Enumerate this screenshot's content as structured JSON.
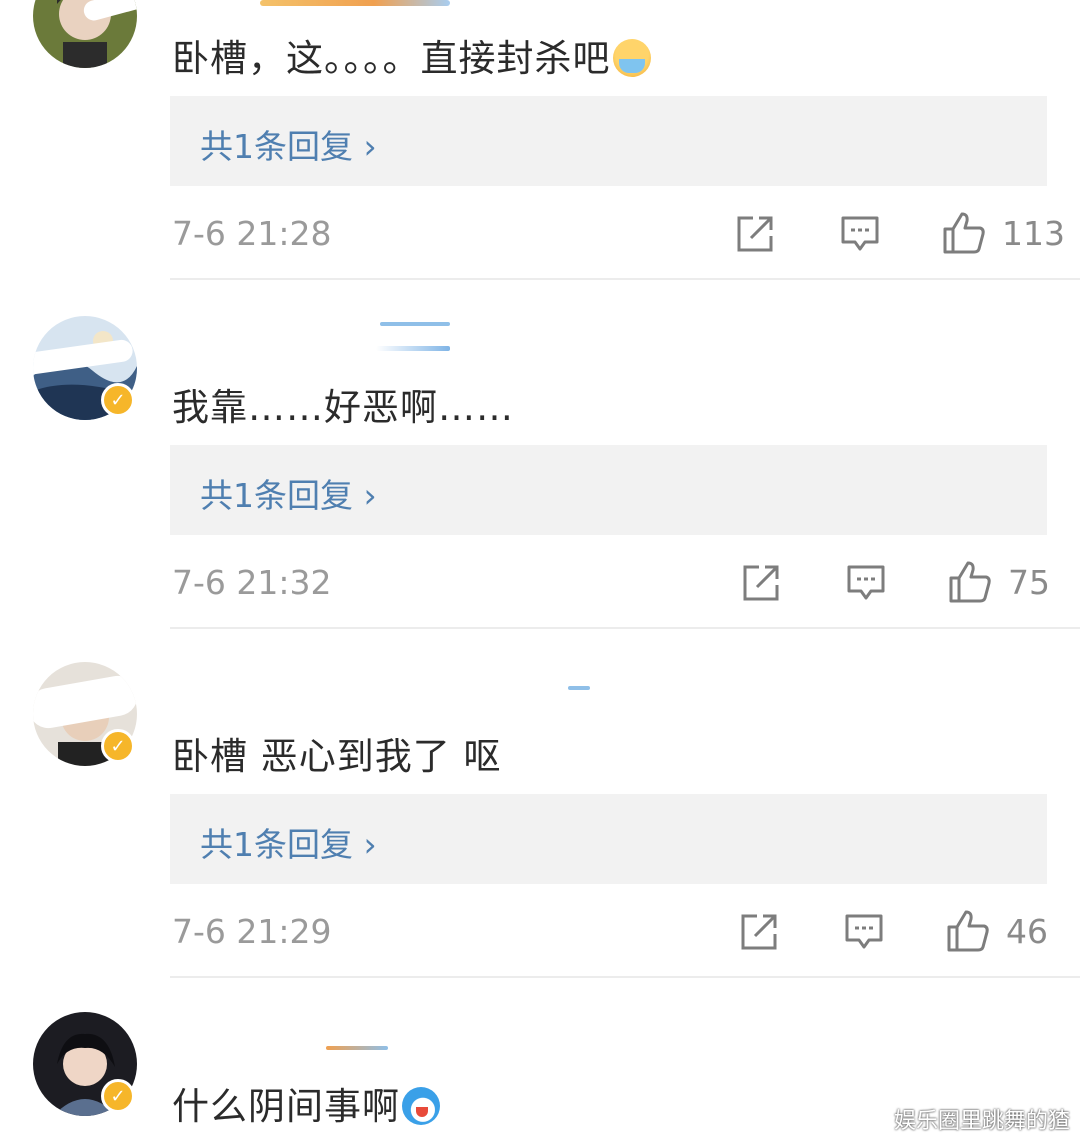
{
  "comments": [
    {
      "text": "卧槽，这。。。。直接封杀吧",
      "emoji": "cold-sweat-emoji",
      "reply_label": "共1条回复 ›",
      "time": "7-6 21:28",
      "likes": "113",
      "verified": false
    },
    {
      "text": "我靠……好恶啊……",
      "reply_label": "共1条回复 ›",
      "time": "7-6 21:32",
      "likes": "75",
      "verified": true
    },
    {
      "text": "卧槽 恶心到我了 呕",
      "reply_label": "共1条回复 ›",
      "time": "7-6 21:29",
      "likes": "46",
      "verified": true
    },
    {
      "text": "什么阴间事啊",
      "emoji": "doraemon-emoji",
      "verified": true
    }
  ],
  "icons": {
    "share": "share-icon",
    "comment": "comment-icon",
    "like": "thumbs-up-icon"
  },
  "colors": {
    "reply_link": "#4f7fb0",
    "reply_bg": "#f2f2f2",
    "verified_badge": "#f6b62a",
    "meta_text": "#9a9a9a"
  },
  "watermark": "娱乐圈里跳舞的猹"
}
